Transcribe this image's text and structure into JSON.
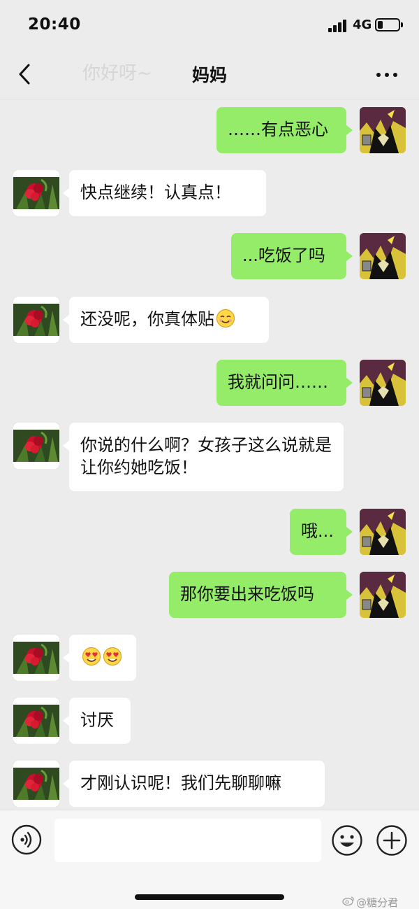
{
  "status": {
    "time": "20:40",
    "network": "4G"
  },
  "nav": {
    "title": "妈妈",
    "ghost_text": "你好呀~",
    "back": "back",
    "more": "more"
  },
  "messages": [
    {
      "side": "sent",
      "text": "……有点恶心"
    },
    {
      "side": "recv",
      "text": "快点继续！认真点！"
    },
    {
      "side": "sent",
      "text": "...吃饭了吗"
    },
    {
      "side": "recv",
      "text": "还没呢，你真体贴",
      "emoji": "smiling-face"
    },
    {
      "side": "sent",
      "text": "我就问问……"
    },
    {
      "side": "recv",
      "text": "你说的什么啊？女孩子这么说就是让你约她吃饭！"
    },
    {
      "side": "sent",
      "text": "哦..."
    },
    {
      "side": "sent",
      "text": "那你要出来吃饭吗"
    },
    {
      "side": "recv",
      "text": "",
      "emoji": "heart-eyes x2"
    },
    {
      "side": "recv",
      "text": "讨厌"
    },
    {
      "side": "recv",
      "text": "才刚认识呢！我们先聊聊嘛"
    }
  ],
  "input": {
    "placeholder": "",
    "value": ""
  },
  "watermark": "@糖分君",
  "colors": {
    "sent_bubble": "#95ec69",
    "recv_bubble": "#ffffff",
    "background": "#ececec"
  }
}
